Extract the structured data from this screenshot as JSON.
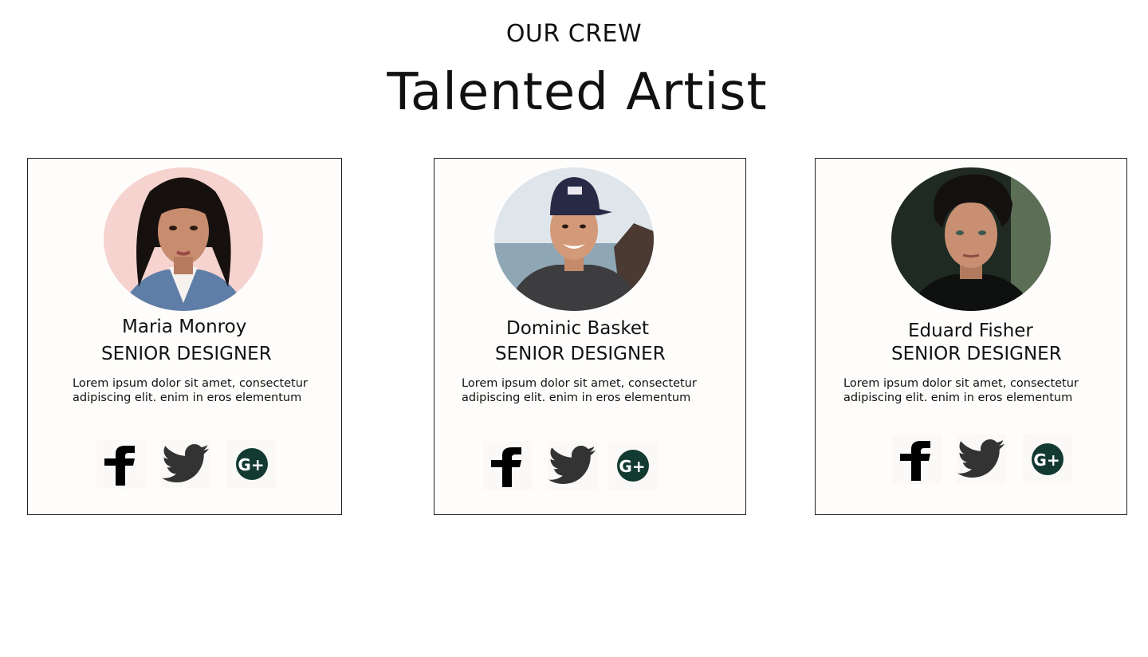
{
  "header": {
    "eyebrow": "OUR CREW",
    "title": "Talented Artist"
  },
  "team": [
    {
      "name": "Maria Monroy",
      "role": "SENIOR DESIGNER",
      "bio": "Lorem ipsum dolor sit amet, consectetur adipiscing elit. enim in eros elementum",
      "photo": "woman-portrait-pink-background"
    },
    {
      "name": "Dominic Basket",
      "role": "SENIOR DESIGNER",
      "bio": "Lorem ipsum dolor sit amet, consectetur adipiscing elit. enim in eros elementum",
      "photo": "man-portrait-cap-seaside"
    },
    {
      "name": "Eduard Fisher",
      "role": "SENIOR DESIGNER",
      "bio": "Lorem ipsum dolor sit amet, consectetur adipiscing elit. enim in eros elementum",
      "photo": "man-portrait-dark-background"
    }
  ],
  "social_icons": [
    "facebook-icon",
    "twitter-icon",
    "google-plus-icon"
  ],
  "colors": {
    "text": "#111111",
    "card_border": "#222222",
    "facebook": "#000000",
    "twitter": "#333333",
    "google_plus": "#123a31"
  }
}
